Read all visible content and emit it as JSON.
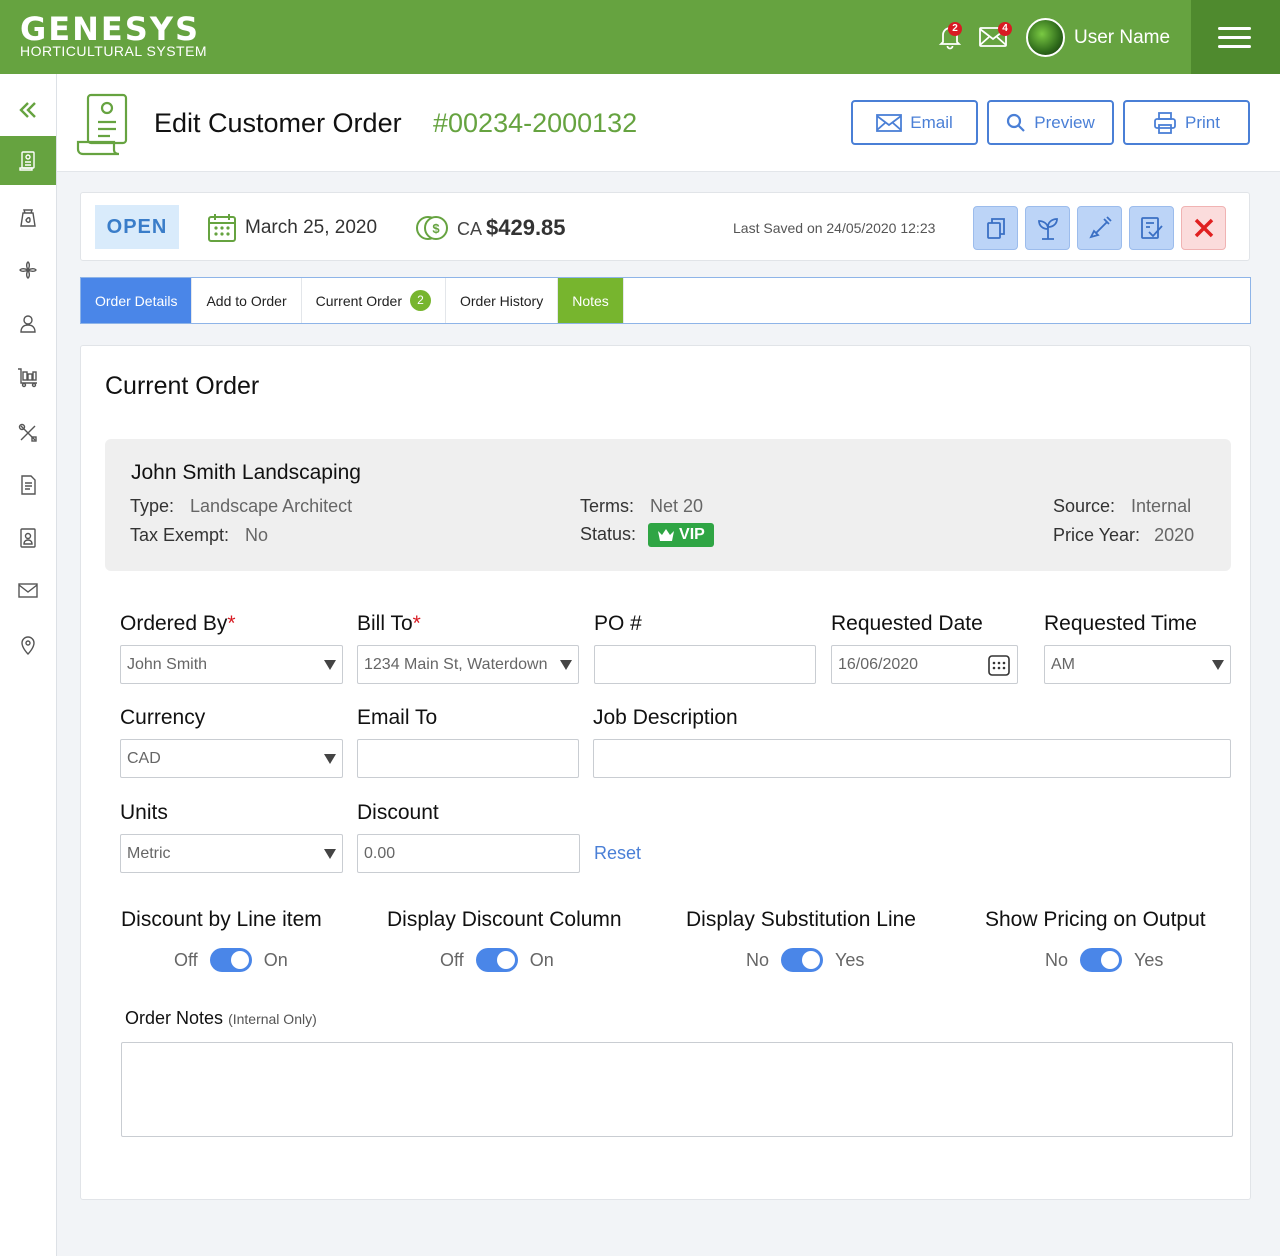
{
  "brand": {
    "title": "GENESYS",
    "subtitle": "HORTICULTURAL SYSTEM"
  },
  "topbar": {
    "notifications_count": "2",
    "messages_count": "4",
    "user_name": "User Name",
    "colors": {
      "bar": "#66a340",
      "menu": "#4f8a2e"
    }
  },
  "sidebar": {
    "items": [
      {
        "icon": "collapse-icon"
      },
      {
        "icon": "orders-icon",
        "active": true
      },
      {
        "icon": "seed-bag-icon"
      },
      {
        "icon": "plant-icon"
      },
      {
        "icon": "customer-icon"
      },
      {
        "icon": "warehouse-cart-icon"
      },
      {
        "icon": "tools-icon"
      },
      {
        "icon": "document-icon"
      },
      {
        "icon": "contact-book-icon"
      },
      {
        "icon": "mail-icon"
      },
      {
        "icon": "location-pin-icon"
      }
    ]
  },
  "header": {
    "title": "Edit Customer Order",
    "order_number": "#00234-2000132",
    "buttons": {
      "email": "Email",
      "preview": "Preview",
      "print": "Print"
    }
  },
  "status_bar": {
    "status": "OPEN",
    "date": "March 25, 2020",
    "currency": "CA",
    "amount": "$429.85",
    "last_saved": "Last Saved on 24/05/2020  12:23",
    "actions": [
      "copy-icon",
      "plant-icon",
      "shovel-icon",
      "checklist-icon",
      "close-icon"
    ]
  },
  "tabs": [
    {
      "label": "Order Details",
      "state": "active"
    },
    {
      "label": "Add to Order"
    },
    {
      "label": "Current Order",
      "badge": "2"
    },
    {
      "label": "Order History"
    },
    {
      "label": "Notes",
      "state": "green"
    }
  ],
  "panel": {
    "title": "Current Order",
    "customer": {
      "name": "John Smith Landscaping",
      "type_label": "Type:",
      "type": "Landscape Architect",
      "tax_label": "Tax Exempt:",
      "tax": "No",
      "terms_label": "Terms:",
      "terms": "Net 20",
      "status_label": "Status:",
      "status": "VIP",
      "source_label": "Source:",
      "source": "Internal",
      "price_year_label": "Price Year:",
      "price_year": "2020"
    },
    "form": {
      "ordered_by": {
        "label": "Ordered By",
        "value": "John Smith"
      },
      "bill_to": {
        "label": "Bill To",
        "value": "1234 Main St, Waterdown"
      },
      "po": {
        "label": "PO #",
        "value": ""
      },
      "requested_date": {
        "label": "Requested Date",
        "value": "16/06/2020"
      },
      "requested_time": {
        "label": "Requested Time",
        "value": "AM"
      },
      "currency": {
        "label": "Currency",
        "value": "CAD"
      },
      "email_to": {
        "label": "Email To",
        "value": ""
      },
      "job_description": {
        "label": "Job Description",
        "value": ""
      },
      "units": {
        "label": "Units",
        "value": "Metric"
      },
      "discount": {
        "label": "Discount",
        "value": "0.00",
        "reset": "Reset"
      }
    },
    "toggles": [
      {
        "title": "Discount by Line item",
        "off": "Off",
        "on": "On",
        "value": true
      },
      {
        "title": "Display Discount Column",
        "off": "Off",
        "on": "On",
        "value": true
      },
      {
        "title": "Display Substitution Line",
        "off": "No",
        "on": "Yes",
        "value": true
      },
      {
        "title": "Show Pricing on Output",
        "off": "No",
        "on": "Yes",
        "value": true
      }
    ],
    "notes": {
      "label": "Order Notes",
      "hint": "(Internal Only)",
      "value": ""
    }
  }
}
